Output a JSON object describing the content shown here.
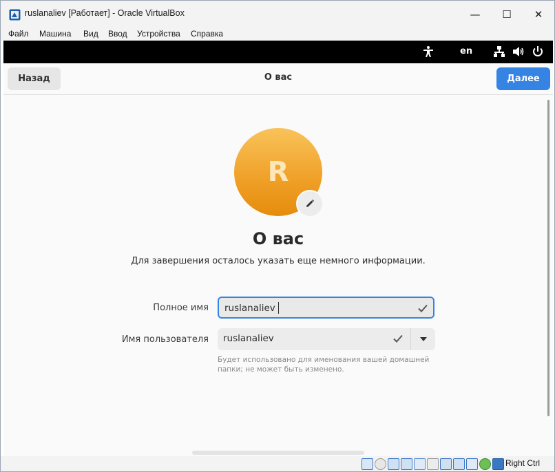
{
  "window": {
    "title": "ruslanaliev [Работает] - Oracle VirtualBox",
    "minimize": "—",
    "maximize": "☐",
    "close": "✕"
  },
  "menu": [
    "Файл",
    "Машина",
    "Вид",
    "Ввод",
    "Устройства",
    "Справка"
  ],
  "topbar": {
    "language": "en"
  },
  "header": {
    "back_label": "Назад",
    "title": "О вас",
    "next_label": "Далее"
  },
  "avatar": {
    "letter": "R",
    "colors": [
      "#f9c35a",
      "#e58c0c"
    ]
  },
  "page": {
    "heading": "О вас",
    "subtitle": "Для завершения осталось указать еще немного информации."
  },
  "form": {
    "full_name_label": "Полное имя",
    "full_name_value": "ruslanaliev",
    "username_label": "Имя пользователя",
    "username_value": "ruslanaliev",
    "username_hint": "Будет использовано для именования вашей домашней папки; не может быть изменено."
  },
  "statusbar": {
    "host_key": "Right Ctrl"
  },
  "colors": {
    "accent": "#3584e4"
  }
}
